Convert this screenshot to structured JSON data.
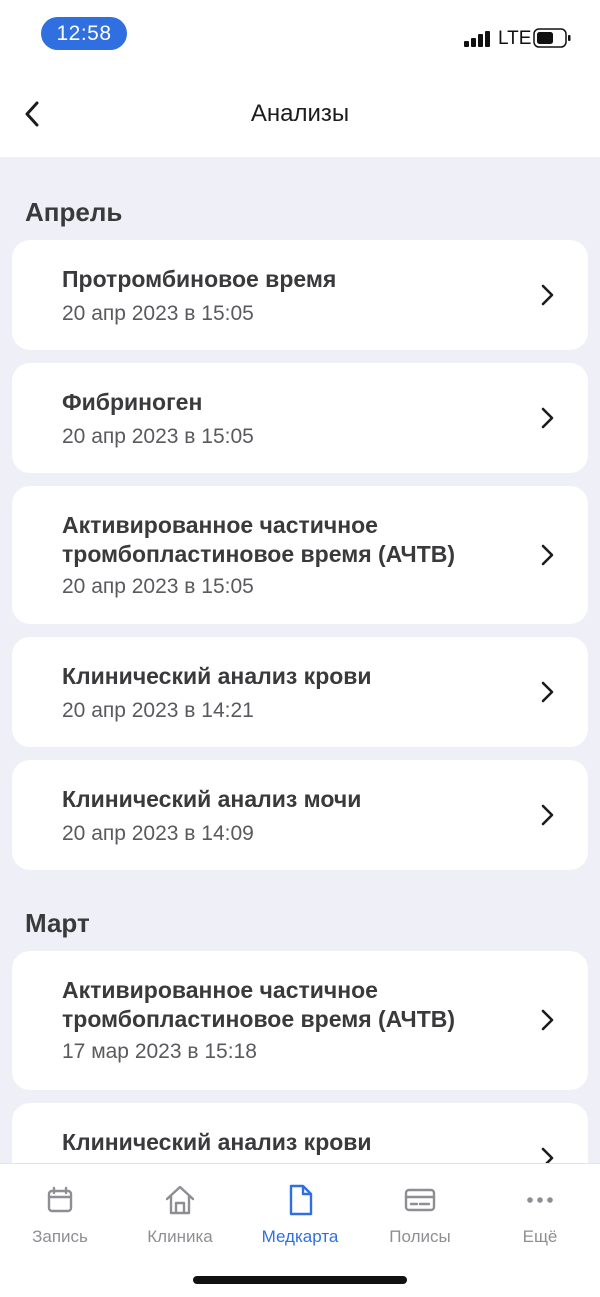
{
  "status_bar": {
    "time": "12:58",
    "network": "LTE"
  },
  "nav": {
    "title": "Анализы"
  },
  "sections": [
    {
      "title": "Апрель"
    },
    {
      "title": "Март"
    }
  ],
  "items": [
    {
      "name": "Протромбиновое время",
      "date": "20 апр 2023 в 15:05"
    },
    {
      "name": "Фибриноген",
      "date": "20 апр 2023 в 15:05"
    },
    {
      "name": "Активированное частичное тромбопластиновое время (АЧТВ)",
      "date": "20 апр 2023 в 15:05"
    },
    {
      "name": "Клинический анализ крови",
      "date": "20 апр 2023 в 14:21"
    },
    {
      "name": "Клинический анализ мочи",
      "date": "20 апр 2023 в 14:09"
    },
    {
      "name": "Активированное частичное тромбопластиновое время (АЧТВ)",
      "date": "17 мар 2023 в 15:18"
    },
    {
      "name": "Клинический анализ крови",
      "date": ""
    }
  ],
  "tabs": [
    {
      "label": "Запись",
      "icon": "calendar-icon"
    },
    {
      "label": "Клиника",
      "icon": "home-icon"
    },
    {
      "label": "Медкарта",
      "icon": "document-icon",
      "active": true
    },
    {
      "label": "Полисы",
      "icon": "card-icon"
    },
    {
      "label": "Ещё",
      "icon": "more-icon"
    }
  ],
  "colors": {
    "accent": "#2f6fe0",
    "background": "#efeff7",
    "inactive": "#8e8e93"
  }
}
